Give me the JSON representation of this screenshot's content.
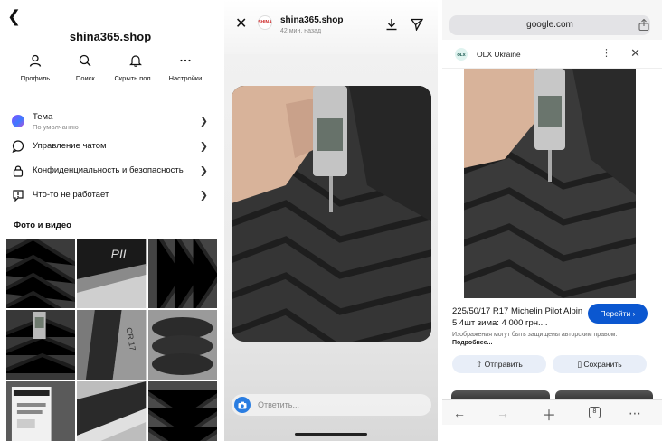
{
  "panel1": {
    "title": "shina365.shop",
    "actions": [
      {
        "label": "Профиль",
        "icon": "person-icon"
      },
      {
        "label": "Поиск",
        "icon": "search-icon"
      },
      {
        "label": "Скрыть пол...",
        "icon": "bell-icon"
      },
      {
        "label": "Настройки",
        "icon": "more-icon"
      }
    ],
    "menu": [
      {
        "label": "Тема",
        "sub": "По умолчанию",
        "icon": "theme-icon"
      },
      {
        "label": "Управление чатом",
        "icon": "chat-icon"
      },
      {
        "label": "Конфиденциальность и безопасность",
        "icon": "lock-icon"
      },
      {
        "label": "Что-то не работает",
        "icon": "alert-icon"
      }
    ],
    "section_title": "Фото и видео"
  },
  "panel2": {
    "account": "shina365.shop",
    "time": "42 мин. назад",
    "reply_placeholder": "Ответить..."
  },
  "panel3": {
    "url": "google.com",
    "source": "OLX Ukraine",
    "result_title": "225/50/17 R17 Michelin Pilot Alpin 5 4шт зима: 4 000 грн....",
    "visit_label": "Перейти",
    "copyright_text": "Изображения могут быть защищены авторским правом.",
    "copyright_more": "Подробнее...",
    "send_label": "Отправить",
    "save_label": "Сохранить",
    "tabs_count": "8"
  }
}
